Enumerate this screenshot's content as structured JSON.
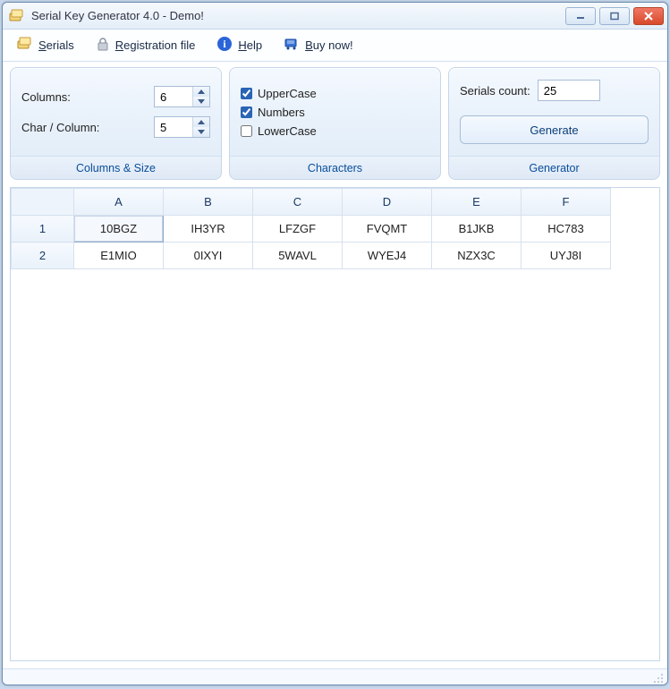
{
  "title": "Serial Key Generator 4.0 - Demo!",
  "toolbar": {
    "serials": "Serials",
    "registration": "Registration file",
    "help": "Help",
    "buy": "Buy now!"
  },
  "panels": {
    "columns_size": {
      "col_label": "Columns:",
      "col_value": "6",
      "char_label": "Char / Column:",
      "char_value": "5",
      "title": "Columns & Size"
    },
    "characters": {
      "upper": "UpperCase",
      "numbers": "Numbers",
      "lower": "LowerCase",
      "title": "Characters",
      "upper_checked": true,
      "numbers_checked": true,
      "lower_checked": false
    },
    "generator": {
      "count_label": "Serials count:",
      "count_value": "25",
      "button": "Generate",
      "title": "Generator"
    }
  },
  "grid": {
    "headers": [
      "A",
      "B",
      "C",
      "D",
      "E",
      "F"
    ],
    "rows": [
      {
        "n": "1",
        "cells": [
          "10BGZ",
          "IH3YR",
          "LFZGF",
          "FVQMT",
          "B1JKB",
          "HC783"
        ]
      },
      {
        "n": "2",
        "cells": [
          "E1MIO",
          "0IXYI",
          "5WAVL",
          "WYEJ4",
          "NZX3C",
          "UYJ8I"
        ]
      }
    ],
    "selected": {
      "row": 0,
      "col": 0
    }
  }
}
